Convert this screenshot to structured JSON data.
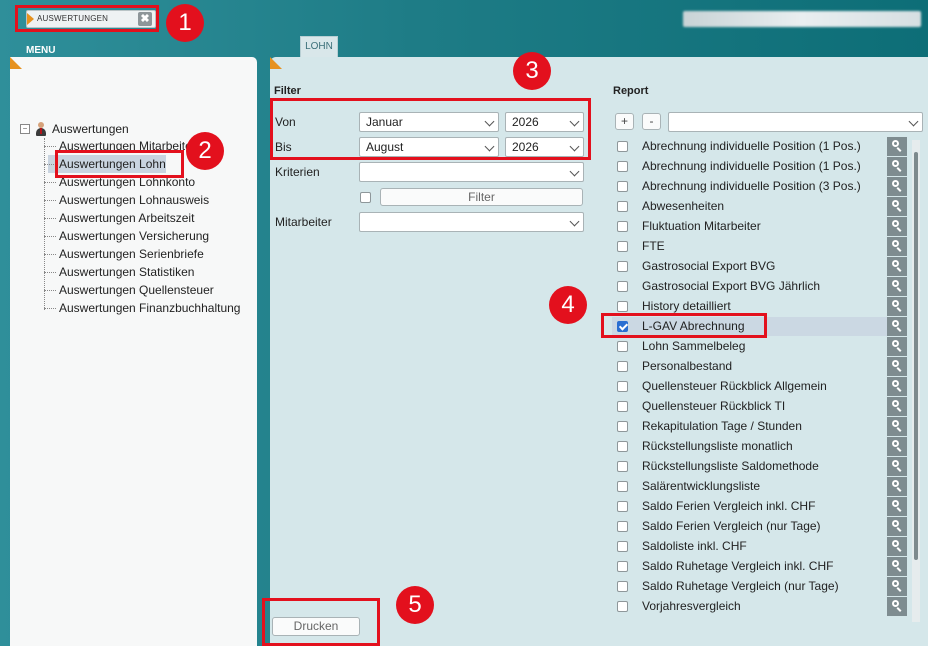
{
  "top_bar": {
    "tab_label": "AUSWERTUNGEN",
    "close_symbol": "✖",
    "menu_label": "MENU",
    "module_tab": "LOHN"
  },
  "tree": {
    "root": "Auswertungen",
    "expander": "−",
    "items": [
      "Auswertungen Mitarbeiter",
      "Auswertungen Lohn",
      "Auswertungen Lohnkonto",
      "Auswertungen Lohnausweis",
      "Auswertungen Arbeitszeit",
      "Auswertungen Versicherung",
      "Auswertungen Serienbriefe",
      "Auswertungen Statistiken",
      "Auswertungen Quellensteuer",
      "Auswertungen Finanzbuchhaltung"
    ],
    "selected_index": 1
  },
  "filter": {
    "title": "Filter",
    "von_label": "Von",
    "bis_label": "Bis",
    "von_month": "Januar",
    "von_year": "2026",
    "bis_month": "August",
    "bis_year": "2026",
    "kriterien_label": "Kriterien",
    "kriterien_value": "",
    "filter_button": "Filter",
    "mitarbeiter_label": "Mitarbeiter",
    "mitarbeiter_value": ""
  },
  "report": {
    "title": "Report",
    "expand_all": "+",
    "collapse_all": "-",
    "dropdown_value": "",
    "items": [
      {
        "label": "Abrechnung individuelle Position (1 Pos.)",
        "checked": false
      },
      {
        "label": "Abrechnung individuelle Position (1 Pos.)",
        "checked": false
      },
      {
        "label": "Abrechnung individuelle Position (3 Pos.)",
        "checked": false
      },
      {
        "label": "Abwesenheiten",
        "checked": false
      },
      {
        "label": "Fluktuation Mitarbeiter",
        "checked": false
      },
      {
        "label": "FTE",
        "checked": false
      },
      {
        "label": "Gastrosocial Export BVG",
        "checked": false
      },
      {
        "label": "Gastrosocial Export BVG Jährlich",
        "checked": false
      },
      {
        "label": "History detailliert",
        "checked": false
      },
      {
        "label": "L-GAV Abrechnung",
        "checked": true
      },
      {
        "label": "Lohn Sammelbeleg",
        "checked": false
      },
      {
        "label": "Personalbestand",
        "checked": false
      },
      {
        "label": "Quellensteuer Rückblick Allgemein",
        "checked": false
      },
      {
        "label": "Quellensteuer Rückblick TI",
        "checked": false
      },
      {
        "label": "Rekapitulation Tage / Stunden",
        "checked": false
      },
      {
        "label": "Rückstellungsliste monatlich",
        "checked": false
      },
      {
        "label": "Rückstellungsliste Saldomethode",
        "checked": false
      },
      {
        "label": "Salärentwicklungsliste",
        "checked": false
      },
      {
        "label": "Saldo Ferien Vergleich inkl. CHF",
        "checked": false
      },
      {
        "label": "Saldo Ferien Vergleich (nur Tage)",
        "checked": false
      },
      {
        "label": "Saldoliste inkl. CHF",
        "checked": false
      },
      {
        "label": "Saldo Ruhetage Vergleich inkl. CHF",
        "checked": false
      },
      {
        "label": "Saldo Ruhetage Vergleich (nur Tage)",
        "checked": false
      },
      {
        "label": "Vorjahresvergleich",
        "checked": false
      }
    ]
  },
  "print_button": "Drucken",
  "callouts": [
    "1",
    "2",
    "3",
    "4",
    "5"
  ],
  "colors": {
    "callout_red": "#e3101d",
    "accent_orange": "#e6921f",
    "header_teal": "#1e7c86",
    "check_blue": "#2a6fd1"
  }
}
